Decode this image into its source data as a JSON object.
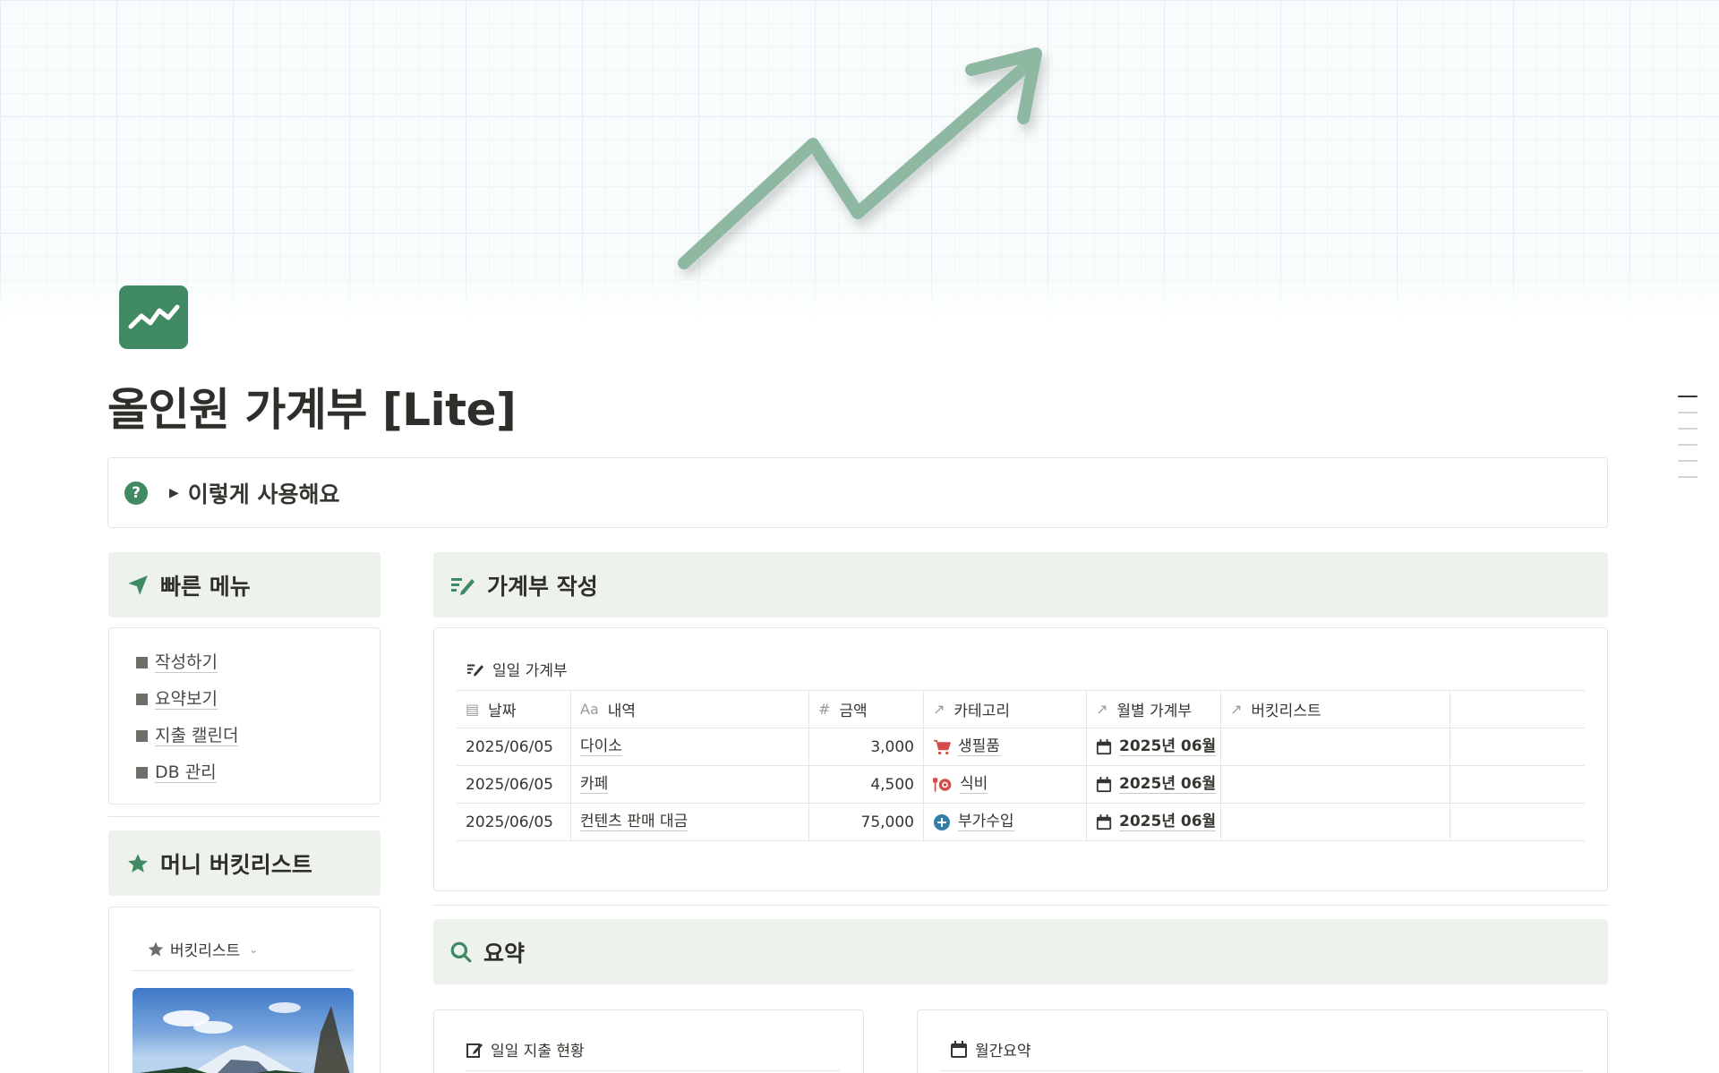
{
  "page": {
    "title": "올인원 가계부 [Lite]",
    "accent_color": "#3f8a63",
    "callout_bg": "#edf3ec"
  },
  "toggle": {
    "label": "이렇게 사용해요",
    "icon": "question-circle-icon"
  },
  "quick_menu": {
    "title": "빠른 메뉴",
    "icon": "navigation-arrow-icon",
    "items": [
      {
        "label": "작성하기"
      },
      {
        "label": "요약보기"
      },
      {
        "label": "지출 캘린더"
      },
      {
        "label": "DB 관리"
      }
    ]
  },
  "bucket": {
    "title": "머니 버킷리스트",
    "icon": "star-icon",
    "view_label": "버킷리스트"
  },
  "ledger": {
    "title": "가계부 작성",
    "icon": "write-icon",
    "db_title": "일일 가계부",
    "columns": [
      "날짜",
      "내역",
      "금액",
      "카테고리",
      "월별 가계부",
      "버킷리스트"
    ],
    "column_icons": [
      "calendar-icon",
      "text-icon",
      "number-icon",
      "relation-icon",
      "relation-icon",
      "relation-icon"
    ],
    "column_icon_glyphs": [
      "▤",
      "Aa",
      "#",
      "↗",
      "↗",
      "↗"
    ],
    "rows": [
      {
        "date": "2025/06/05",
        "desc": "다이소",
        "amount": "3,000",
        "category": "생필품",
        "category_icon": "cart-icon",
        "month": "2025년 06월"
      },
      {
        "date": "2025/06/05",
        "desc": "카페",
        "amount": "4,500",
        "category": "식비",
        "category_icon": "dining-icon",
        "month": "2025년 06월"
      },
      {
        "date": "2025/06/05",
        "desc": "컨텐츠 판매 대금",
        "amount": "75,000",
        "category": "부가수입",
        "category_icon": "plus-circle-icon",
        "month": "2025년 06월"
      }
    ]
  },
  "summary": {
    "title": "요약",
    "icon": "search-icon",
    "daily_title": "일일 지출 현황",
    "monthly_title": "월간요약"
  }
}
